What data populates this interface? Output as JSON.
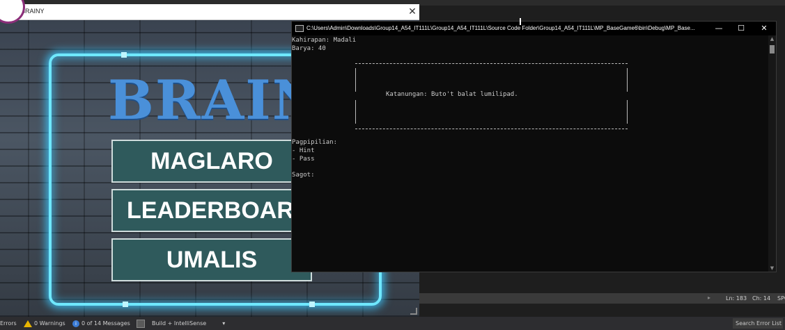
{
  "game_window": {
    "title": "BRAINY",
    "close_glyph": "✕",
    "logo_text": "BRAINY",
    "buttons": {
      "play": "MAGLARO",
      "leaderboard": "LEADERBOARD",
      "quit": "UMALIS"
    }
  },
  "console_window": {
    "title": "C:\\Users\\Admin\\Downloads\\Group14_A54_IT111L\\Group14_A54_IT111L\\Source Code Folder\\Group14_A54_IT111L\\MP_BaseGame6\\bin\\Debug\\MP_Base...",
    "min_glyph": "—",
    "max_glyph": "☐",
    "close_glyph": "✕",
    "lines": {
      "difficulty": "Kahirapan: Madali",
      "money": "Barya: 40",
      "question": "Katanungan: Buto't balat lumilipad.",
      "options_header": "Pagpipilian:",
      "option_hint": "- Hint",
      "option_pass": "- Pass",
      "answer_prompt": "Sagot:"
    },
    "scroll_up": "▲",
    "scroll_down": "▼"
  },
  "ide": {
    "status": {
      "line": "Ln: 183",
      "column": "Ch: 14",
      "spc": "SPC"
    },
    "bottom_bar": {
      "errors": "Errors",
      "warnings": "0 Warnings",
      "messages": "0 of 14 Messages",
      "build_filter": "Build + IntelliSense",
      "search_placeholder": "Search Error List"
    }
  },
  "colors": {
    "neon": "#6fe8ff",
    "logo": "#4a90d9",
    "button_bg": "#2f5a5c"
  }
}
